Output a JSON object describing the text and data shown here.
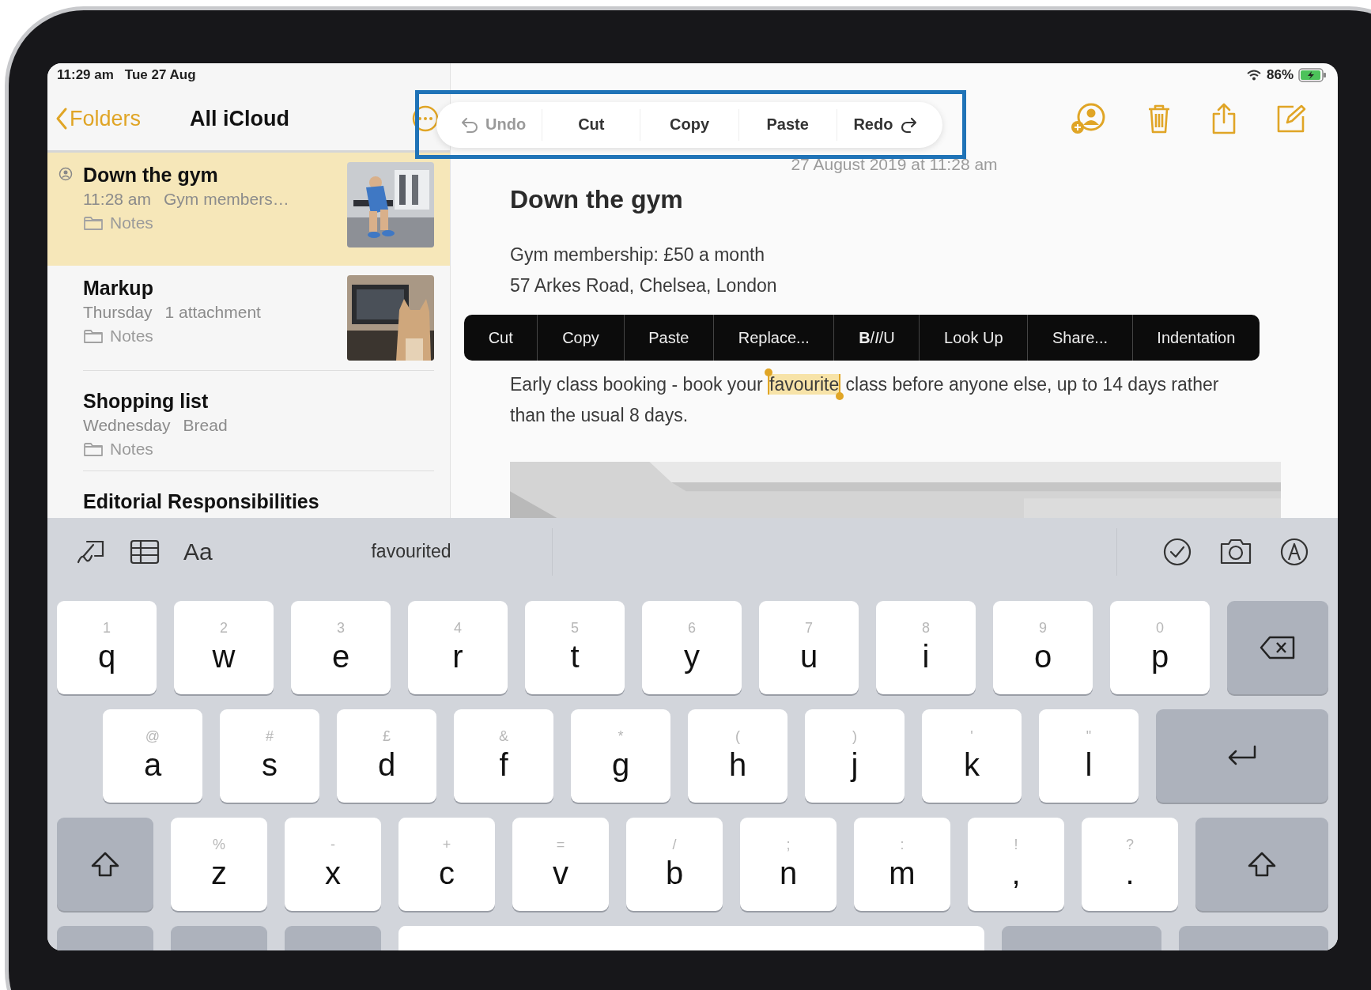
{
  "status_bar": {
    "time": "11:29 am",
    "date": "Tue 27 Aug",
    "battery": "86%"
  },
  "sidebar": {
    "back": "Folders",
    "title": "All iCloud",
    "notes": [
      {
        "title": "Down the gym",
        "time": "11:28 am",
        "preview": "Gym members…",
        "folder": "Notes",
        "selected": true,
        "shared": true
      },
      {
        "title": "Markup",
        "time": "Thursday",
        "preview": "1 attachment",
        "folder": "Notes",
        "selected": false,
        "shared": false
      },
      {
        "title": "Shopping list",
        "time": "Wednesday",
        "preview": "Bread",
        "folder": "Notes",
        "selected": false,
        "shared": false
      },
      {
        "title": "Editorial Responsibilities",
        "selected": false,
        "shared": false
      }
    ]
  },
  "edit_toolbar": [
    {
      "label": "Undo",
      "kind": "undo",
      "disabled": true
    },
    {
      "label": "Cut",
      "kind": "plain",
      "disabled": false
    },
    {
      "label": "Copy",
      "kind": "plain",
      "disabled": false
    },
    {
      "label": "Paste",
      "kind": "plain",
      "disabled": false
    },
    {
      "label": "Redo",
      "kind": "redo",
      "disabled": false
    }
  ],
  "note": {
    "date": "27 August 2019 at 11:28 am",
    "title": "Down the gym",
    "lines": [
      "Gym membership: £50 a month",
      "57 Arkes Road, Chelsea, London"
    ],
    "paragraph": {
      "before": "Early class booking - book your ",
      "selection": "favourite",
      "after": " class before anyone else, up to 14 days rather than the usual 8 days."
    }
  },
  "context_menu": [
    "Cut",
    "Copy",
    "Paste",
    "Replace...",
    "**B**/*I*/U",
    "Look Up",
    "Share...",
    "Indentation"
  ],
  "keyboard": {
    "format_button": "Aa",
    "suggestions": [
      "favourited"
    ],
    "rows": [
      [
        {
          "kind": "letter",
          "hint": "1",
          "label": "q"
        },
        {
          "kind": "letter",
          "hint": "2",
          "label": "w"
        },
        {
          "kind": "letter",
          "hint": "3",
          "label": "e"
        },
        {
          "kind": "letter",
          "hint": "4",
          "label": "r"
        },
        {
          "kind": "letter",
          "hint": "5",
          "label": "t"
        },
        {
          "kind": "letter",
          "hint": "6",
          "label": "y"
        },
        {
          "kind": "letter",
          "hint": "7",
          "label": "u"
        },
        {
          "kind": "letter",
          "hint": "8",
          "label": "i"
        },
        {
          "kind": "letter",
          "hint": "9",
          "label": "o"
        },
        {
          "kind": "letter",
          "hint": "0",
          "label": "p"
        },
        {
          "kind": "delete"
        }
      ],
      [
        {
          "kind": "letter",
          "hint": "@",
          "label": "a"
        },
        {
          "kind": "letter",
          "hint": "#",
          "label": "s"
        },
        {
          "kind": "letter",
          "hint": "£",
          "label": "d"
        },
        {
          "kind": "letter",
          "hint": "&",
          "label": "f"
        },
        {
          "kind": "letter",
          "hint": "*",
          "label": "g"
        },
        {
          "kind": "letter",
          "hint": "(",
          "label": "h"
        },
        {
          "kind": "letter",
          "hint": ")",
          "label": "j"
        },
        {
          "kind": "letter",
          "hint": "'",
          "label": "k"
        },
        {
          "kind": "letter",
          "hint": "\"",
          "label": "l"
        },
        {
          "kind": "return"
        }
      ],
      [
        {
          "kind": "shift"
        },
        {
          "kind": "letter",
          "hint": "%",
          "label": "z"
        },
        {
          "kind": "letter",
          "hint": "-",
          "label": "x"
        },
        {
          "kind": "letter",
          "hint": "+",
          "label": "c"
        },
        {
          "kind": "letter",
          "hint": "=",
          "label": "v"
        },
        {
          "kind": "letter",
          "hint": "/",
          "label": "b"
        },
        {
          "kind": "letter",
          "hint": ";",
          "label": "n"
        },
        {
          "kind": "letter",
          "hint": ":",
          "label": "m"
        },
        {
          "kind": "letter",
          "hint": "!",
          "label": ","
        },
        {
          "kind": "letter",
          "hint": "?",
          "label": "."
        },
        {
          "kind": "shift"
        }
      ],
      [
        {
          "kind": "function"
        },
        {
          "kind": "function"
        },
        {
          "kind": "function"
        },
        {
          "kind": "space"
        },
        {
          "kind": "function"
        },
        {
          "kind": "function"
        }
      ]
    ]
  }
}
